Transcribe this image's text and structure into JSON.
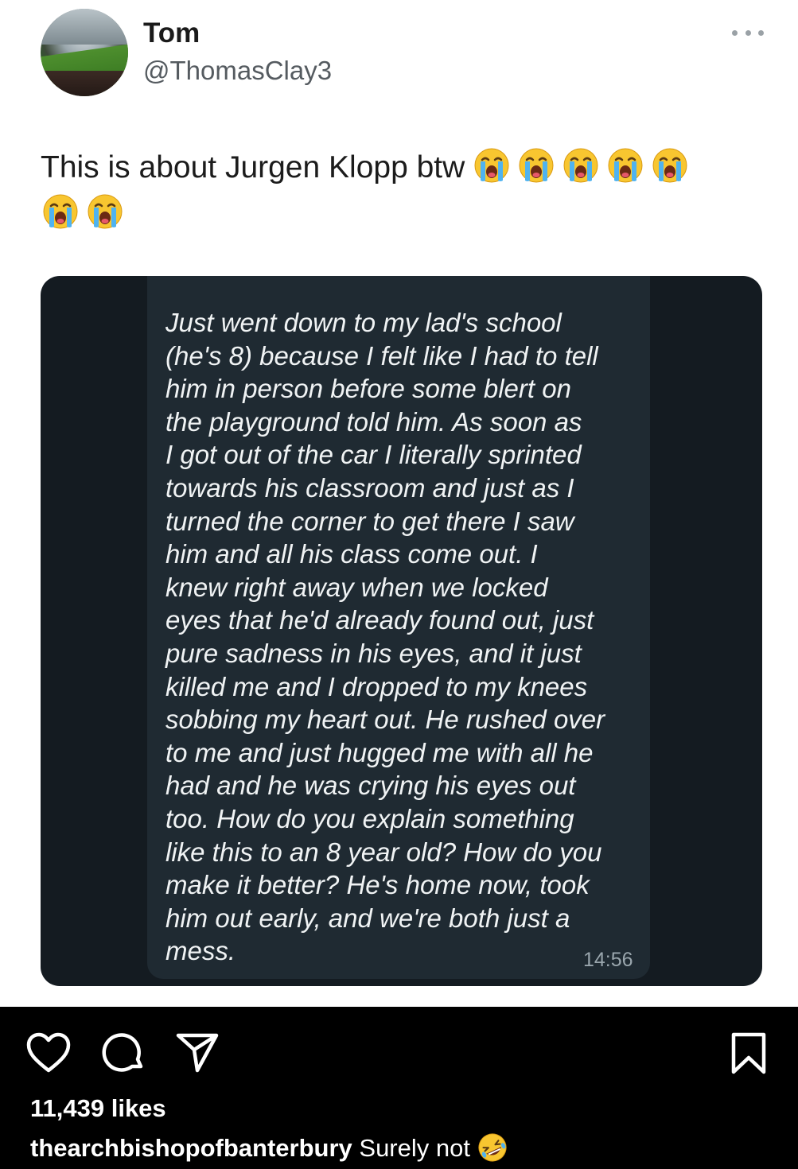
{
  "tweet": {
    "display_name": "Tom",
    "handle": "@ThomasClay3",
    "text": "This is about Jurgen Klopp btw",
    "emoji": "loudly-crying-face",
    "emoji_count": 7
  },
  "message": {
    "text": "Just went down to my lad's school\n(he's 8) because I felt like I had to tell\nhim in person before some blert on\nthe playground told him. As soon as\nI got out of the car I literally sprinted\ntowards his classroom and just as I\nturned the corner to get there I saw\nhim and all his class come out. I\nknew right away when we locked\neyes that he'd already found out, just\npure sadness in his eyes, and it just\nkilled me and I dropped to my knees\nsobbing my heart out. He rushed over\nto me and just hugged me with all he\nhad and he was crying his eyes out\ntoo. How do you explain something\nlike this to an 8 year old? How do you\nmake it better? He's home now, took\nhim out early, and we're both just a\nmess.",
    "time": "14:56"
  },
  "post": {
    "likes": "11,439 likes",
    "caption_user": "thearchbishopofbanterbury",
    "caption_text": "Surely not",
    "caption_emoji": "rolling-on-floor-laughing"
  },
  "colors": {
    "screenshot_bg": "#141b21",
    "bubble_bg": "#1f2a32",
    "footer_bg": "#000000"
  }
}
